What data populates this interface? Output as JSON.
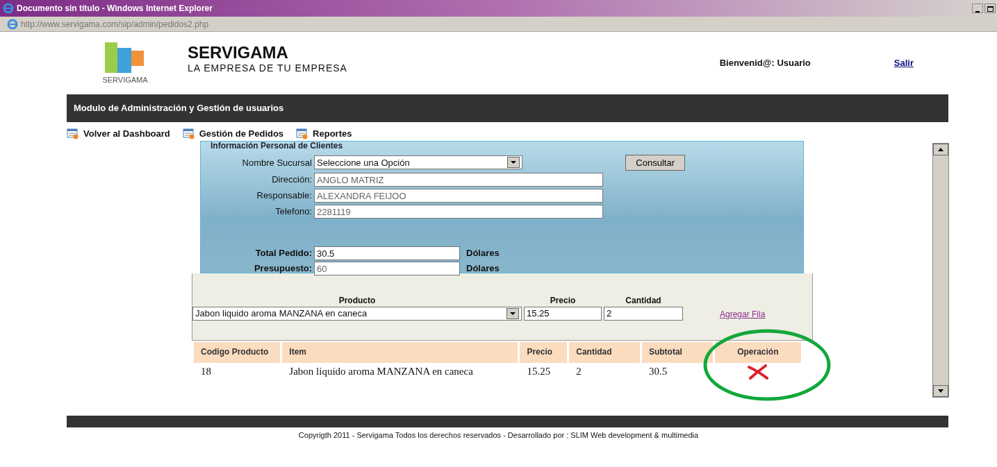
{
  "window": {
    "title": "Documento sin título - Windows Internet Explorer",
    "address": "http://www.servigama.com/sip/admin/pedidos2.php"
  },
  "header": {
    "logo_text": "SERVIGAMA",
    "brand": "SERVIGAMA",
    "slogan": "LA EMPRESA DE TU EMPRESA",
    "welcome": "Bienvenid@: Usuario",
    "logout": "Salir"
  },
  "module_bar": {
    "title": "Modulo de Administración y Gestión de usuarios"
  },
  "nav": [
    {
      "label": "Volver al Dashboard"
    },
    {
      "label": "Gestión de Pedidos"
    },
    {
      "label": "Reportes"
    }
  ],
  "client_form": {
    "heading": "Información Personal de Clientes",
    "branch": {
      "label": "Nombre Sucursal",
      "value": "Seleccione una Opción"
    },
    "query_button": "Consultar",
    "fields": [
      {
        "label": "Dirección:",
        "value": "ANGLO MATRIZ"
      },
      {
        "label": "Responsable:",
        "value": "ALEXANDRA FEIJOO"
      },
      {
        "label": "Telefono:",
        "value": "2281119"
      }
    ],
    "totals": [
      {
        "label": "Total Pedido:",
        "value": "30.5",
        "unit": "Dólares",
        "disabled": false
      },
      {
        "label": "Presupuesto:",
        "value": "60",
        "unit": "Dólares",
        "disabled": true
      }
    ]
  },
  "add_row": {
    "product_label": "Producto",
    "product_value": "Jabon liquido aroma MANZANA en caneca",
    "price_label": "Precio",
    "price_value": "15.25",
    "qty_label": "Cantidad",
    "qty_value": "2",
    "link": "Agregar Fila"
  },
  "table": {
    "columns": [
      "Codigo Producto",
      "Item",
      "Precio",
      "Cantidad",
      "Subtotal",
      "Operación"
    ],
    "rows": [
      {
        "cells": [
          "18",
          "Jabon liquido aroma MANZANA en caneca",
          "15.25",
          "2",
          "30.5"
        ]
      }
    ]
  },
  "footer": {
    "text": "Copyrigth 2011 - Servigama Todos los derechos reservados - Desarrollado por : SLIM Web development & multimedia"
  }
}
